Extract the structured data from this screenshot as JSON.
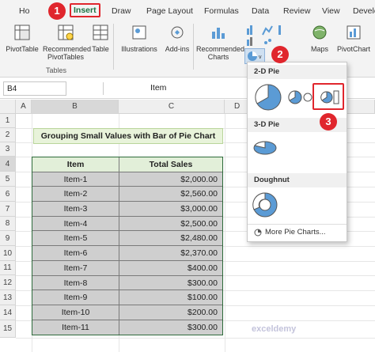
{
  "ribbon_tabs": {
    "home": "Ho",
    "insert": "Insert",
    "draw": "Draw",
    "page_layout": "Page Layout",
    "formulas": "Formulas",
    "data": "Data",
    "review": "Review",
    "view": "View",
    "developer": "Develo"
  },
  "ribbon": {
    "pivottable": "PivotTable",
    "recommended_pivottables": "Recommended PivotTables",
    "table": "Table",
    "illustrations": "Illustrations",
    "addins": "Add-ins",
    "recommended_charts": "Recommended Charts",
    "maps": "Maps",
    "pivotchart": "PivotChart",
    "group_tables": "Tables"
  },
  "formula_bar": {
    "name_box": "B4",
    "formula": "Item"
  },
  "columns": [
    "A",
    "B",
    "C",
    "D"
  ],
  "rows": [
    "1",
    "2",
    "3",
    "4",
    "5",
    "6",
    "7",
    "8",
    "9",
    "10",
    "11",
    "12",
    "13",
    "14",
    "15"
  ],
  "sheet_title": "Grouping Small Values with Bar of Pie Chart",
  "table": {
    "headers": [
      "Item",
      "Total Sales"
    ],
    "rows": [
      [
        "Item-1",
        "$2,000.00"
      ],
      [
        "Item-2",
        "$2,560.00"
      ],
      [
        "Item-3",
        "$3,000.00"
      ],
      [
        "Item-4",
        "$2,500.00"
      ],
      [
        "Item-5",
        "$2,480.00"
      ],
      [
        "Item-6",
        "$2,370.00"
      ],
      [
        "Item-7",
        "$400.00"
      ],
      [
        "Item-8",
        "$300.00"
      ],
      [
        "Item-9",
        "$100.00"
      ],
      [
        "Item-10",
        "$200.00"
      ],
      [
        "Item-11",
        "$300.00"
      ]
    ]
  },
  "dropdown": {
    "section_2d": "2-D Pie",
    "section_3d": "3-D Pie",
    "section_doughnut": "Doughnut",
    "more": "More Pie Charts..."
  },
  "badges": {
    "b1": "1",
    "b2": "2",
    "b3": "3"
  },
  "watermark": "exceldemy",
  "colors": {
    "accent_red": "#e0262d",
    "excel_green": "#1a7343",
    "pie_blue": "#5b9bd5"
  }
}
